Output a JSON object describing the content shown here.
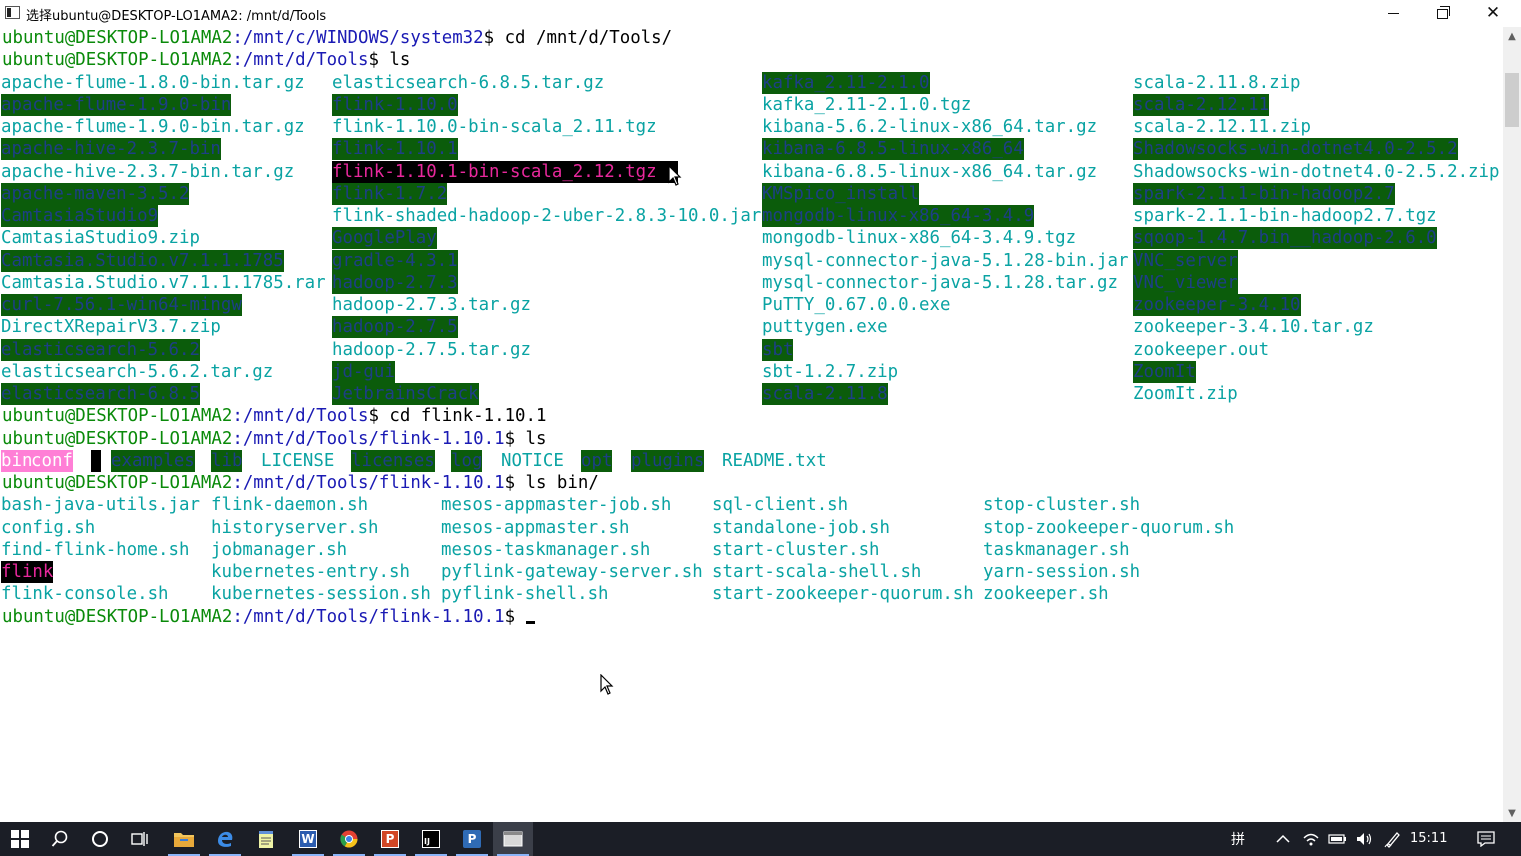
{
  "window": {
    "title": "选择ubuntu@DESKTOP-LO1AMA2: /mnt/d/Tools",
    "minimize_glyph": "",
    "maximize_glyph": "",
    "close_glyph": "✕"
  },
  "colors": {
    "user": "#0a8a0a",
    "path": "#1a1ab4",
    "dir_bg": "#0b5c0b",
    "file": "#0aa3a3",
    "highlight": "#e8289c"
  },
  "terminal": {
    "prompt_user": "ubuntu@DESKTOP-LO1AMA2",
    "lines": [
      {
        "path": ":/mnt/c/WINDOWS/system32",
        "cmd": "$ cd /mnt/d/Tools/"
      },
      {
        "path": ":/mnt/d/Tools",
        "cmd": "$ ls"
      },
      {
        "path": ":/mnt/d/Tools",
        "cmd": "$ cd flink-1.10.1"
      },
      {
        "path": ":/mnt/d/Tools/flink-1.10.1",
        "cmd": "$ ls"
      },
      {
        "path": ":/mnt/d/Tools/flink-1.10.1",
        "cmd": "$ ls bin/"
      },
      {
        "path": ":/mnt/d/Tools/flink-1.10.1",
        "cmd": "$ "
      }
    ],
    "tools_ls": [
      [
        "apache-flume-1.8.0-bin.tar.gz",
        "elasticsearch-6.8.5.tar.gz",
        "kafka_2.11-2.1.0",
        "scala-2.11.8.zip"
      ],
      [
        "apache-flume-1.9.0-bin",
        "flink-1.10.0",
        "kafka_2.11-2.1.0.tgz",
        "scala-2.12.11"
      ],
      [
        "apache-flume-1.9.0-bin.tar.gz",
        "flink-1.10.0-bin-scala_2.11.tgz",
        "kibana-5.6.2-linux-x86_64.tar.gz",
        "scala-2.12.11.zip"
      ],
      [
        "apache-hive-2.3.7-bin",
        "flink-1.10.1",
        "kibana-6.8.5-linux-x86_64",
        "Shadowsocks-win-dotnet4.0-2.5.2"
      ],
      [
        "apache-hive-2.3.7-bin.tar.gz",
        "flink-1.10.1-bin-scala_2.12.tgz",
        "kibana-6.8.5-linux-x86_64.tar.gz",
        "Shadowsocks-win-dotnet4.0-2.5.2.zip"
      ],
      [
        "apache-maven-3.5.2",
        "flink-1.7.2",
        "KMSpico_install",
        "spark-2.1.1-bin-hadoop2.7"
      ],
      [
        "CamtasiaStudio9",
        "flink-shaded-hadoop-2-uber-2.8.3-10.0.jar",
        "mongodb-linux-x86_64-3.4.9",
        "spark-2.1.1-bin-hadoop2.7.tgz"
      ],
      [
        "CamtasiaStudio9.zip",
        "GooglePlay",
        "mongodb-linux-x86_64-3.4.9.tgz",
        "sqoop-1.4.7.bin__hadoop-2.6.0"
      ],
      [
        "Camtasia.Studio.v7.1.1.1785",
        "gradle-4.3.1",
        "mysql-connector-java-5.1.28-bin.jar",
        "VNC_server"
      ],
      [
        "Camtasia.Studio.v7.1.1.1785.rar",
        "hadoop-2.7.3",
        "mysql-connector-java-5.1.28.tar.gz",
        "VNC_viewer"
      ],
      [
        "curl-7.56.1-win64-mingw",
        "hadoop-2.7.3.tar.gz",
        "PuTTY_0.67.0.0.exe",
        "zookeeper-3.4.10"
      ],
      [
        "DirectXRepairV3.7.zip",
        "hadoop-2.7.5",
        "puttygen.exe",
        "zookeeper-3.4.10.tar.gz"
      ],
      [
        "elasticsearch-5.6.2",
        "hadoop-2.7.5.tar.gz",
        "sbt",
        "zookeeper.out"
      ],
      [
        "elasticsearch-5.6.2.tar.gz",
        "jd-gui",
        "sbt-1.2.7.zip",
        "ZoomIt"
      ],
      [
        "elasticsearch-6.8.5",
        "JetbrainsCrack",
        "scala-2.11.8",
        "ZoomIt.zip"
      ]
    ],
    "flink_ls": [
      "bin",
      "conf",
      "examples",
      "lib",
      "LICENSE",
      "licenses",
      "log",
      "NOTICE",
      "opt",
      "plugins",
      "README.txt"
    ],
    "bin_ls": [
      [
        "bash-java-utils.jar",
        "flink-daemon.sh",
        "mesos-appmaster-job.sh",
        "sql-client.sh",
        "stop-cluster.sh"
      ],
      [
        "config.sh",
        "historyserver.sh",
        "mesos-appmaster.sh",
        "standalone-job.sh",
        "stop-zookeeper-quorum.sh"
      ],
      [
        "find-flink-home.sh",
        "jobmanager.sh",
        "mesos-taskmanager.sh",
        "start-cluster.sh",
        "taskmanager.sh"
      ],
      [
        "flink",
        "kubernetes-entry.sh",
        "pyflink-gateway-server.sh",
        "start-scala-shell.sh",
        "yarn-session.sh"
      ],
      [
        "flink-console.sh",
        "kubernetes-session.sh",
        "pyflink-shell.sh",
        "start-zookeeper-quorum.sh",
        "zookeeper.sh"
      ]
    ]
  },
  "taskbar": {
    "items": [
      "start-button",
      "search-icon",
      "cortana-icon",
      "task-view-icon",
      "file-explorer-icon",
      "edge-icon",
      "notepad-icon",
      "word-icon",
      "chrome-icon",
      "powerpoint-icon",
      "intellij-icon",
      "publisher-icon",
      "terminal-icon"
    ],
    "word_letter": "W",
    "ppt_letter": "P",
    "idea_letter": "IJ",
    "pub_letter": "P",
    "ime_char": "拼",
    "clock": "15:11"
  }
}
